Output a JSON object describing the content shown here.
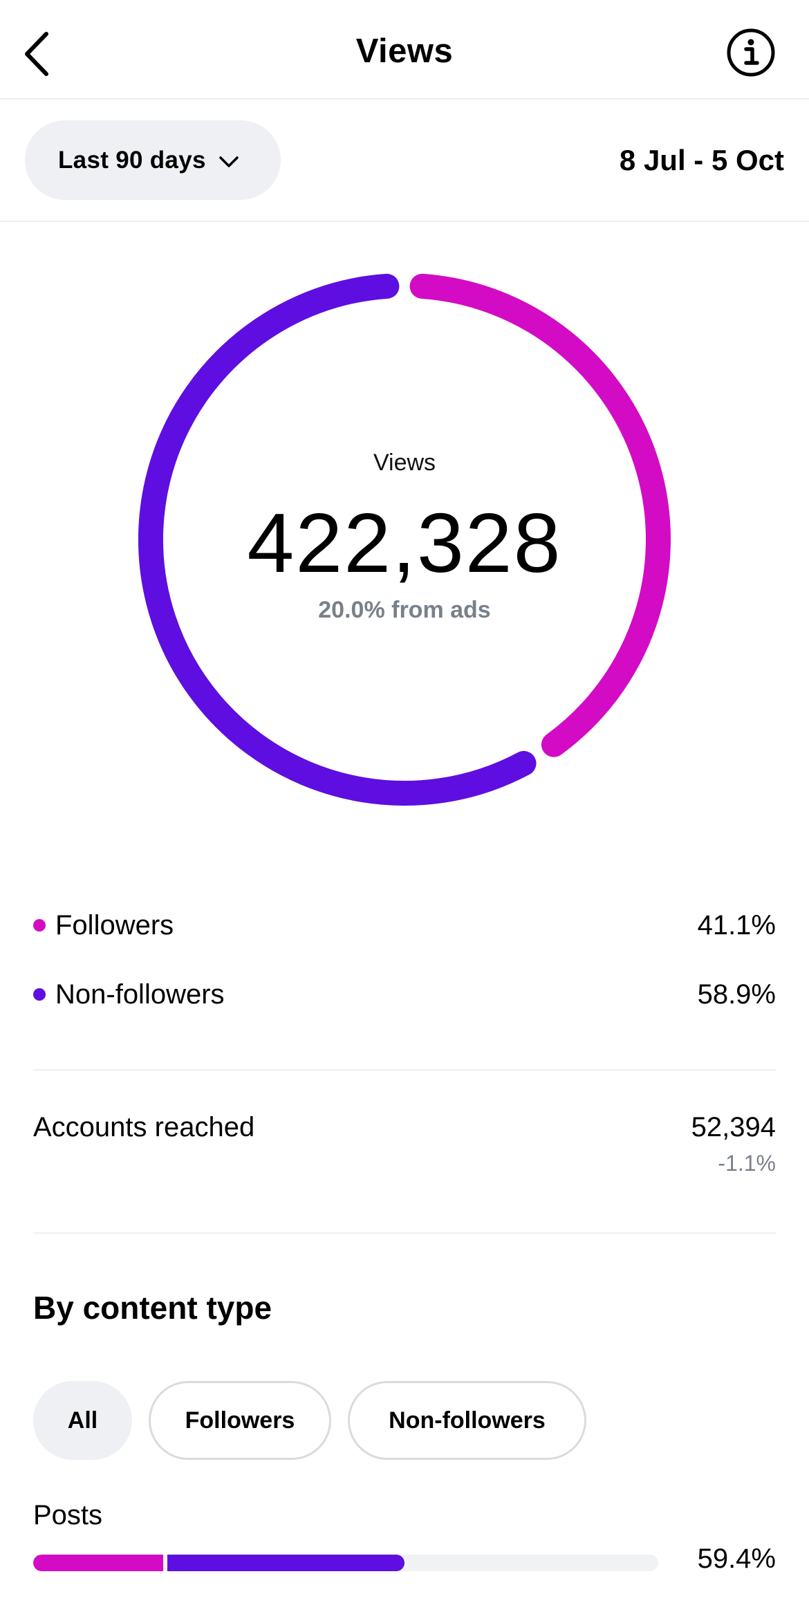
{
  "header": {
    "title": "Views"
  },
  "filter": {
    "range_label": "Last 90 days",
    "date_range": "8 Jul - 5 Oct"
  },
  "donut": {
    "caption": "Views",
    "value": "422,328",
    "subtext": "20.0% from ads",
    "followers_fraction": 0.411,
    "non_followers_fraction": 0.589
  },
  "colors": {
    "followers": "#d30bc5",
    "non_followers": "#5e0ee0"
  },
  "legend": [
    {
      "label": "Followers",
      "value": "41.1%"
    },
    {
      "label": "Non-followers",
      "value": "58.9%"
    }
  ],
  "reach": {
    "label": "Accounts reached",
    "value": "52,394",
    "change": "-1.1%"
  },
  "content_type": {
    "title": "By content type",
    "tabs": [
      {
        "label": "All",
        "active": true
      },
      {
        "label": "Followers",
        "active": false
      },
      {
        "label": "Non-followers",
        "active": false
      }
    ],
    "rows": [
      {
        "label": "Posts",
        "value": "59.4%",
        "followers_share": 0.208,
        "non_followers_share": 0.386
      }
    ]
  }
}
